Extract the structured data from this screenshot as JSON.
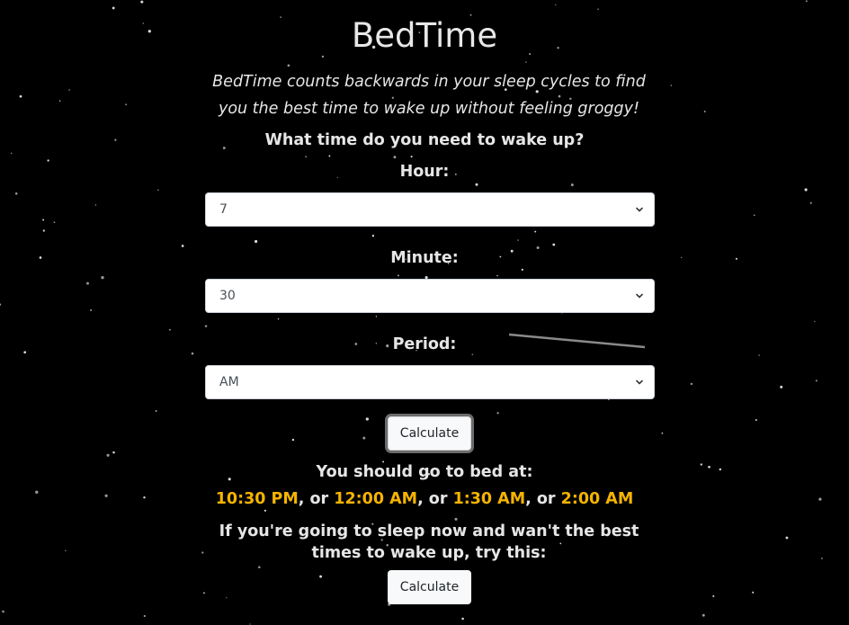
{
  "app": {
    "title": "BedTime",
    "tagline": "BedTime counts backwards in your sleep cycles to find you the best time to wake up without feeling groggy!"
  },
  "form": {
    "question": "What time do you need to wake up?",
    "hour": {
      "label": "Hour:",
      "value": "7"
    },
    "minute": {
      "label": "Minute:",
      "value": "30"
    },
    "period": {
      "label": "Period:",
      "value": "AM"
    },
    "calculate_label": "Calculate"
  },
  "results": {
    "label": "You should go to bed at:",
    "times": [
      "10:30 PM",
      "12:00 AM",
      "1:30 AM",
      "2:00 AM"
    ],
    "separator": ", or "
  },
  "sleep_now": {
    "text": "If you're going to sleep now and wan't the best times to wake up, try this:",
    "calculate_label": "Calculate"
  },
  "colors": {
    "background": "#000000",
    "text": "#e6e6e6",
    "accent": "#f5b400"
  },
  "icons": {
    "select_arrow": "chevron-down-icon"
  }
}
